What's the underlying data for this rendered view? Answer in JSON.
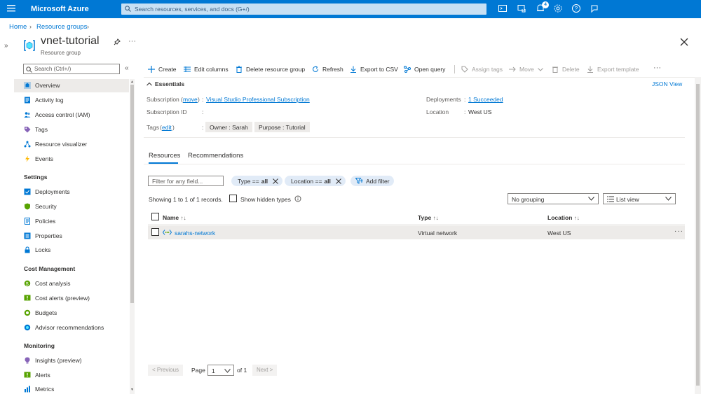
{
  "topbar": {
    "brand": "Microsoft Azure",
    "search_placeholder": "Search resources, services, and docs (G+/)",
    "notification_count": "4"
  },
  "breadcrumb": {
    "home": "Home",
    "resource_groups": "Resource groups"
  },
  "page": {
    "title": "vnet-tutorial",
    "subtitle": "Resource group"
  },
  "nav": {
    "search_placeholder": "Search (Ctrl+/)",
    "items_top": [
      "Overview",
      "Activity log",
      "Access control (IAM)",
      "Tags",
      "Resource visualizer",
      "Events"
    ],
    "settings_header": "Settings",
    "settings_items": [
      "Deployments",
      "Security",
      "Policies",
      "Properties",
      "Locks"
    ],
    "cost_header": "Cost Management",
    "cost_items": [
      "Cost analysis",
      "Cost alerts (preview)",
      "Budgets",
      "Advisor recommendations"
    ],
    "monitoring_header": "Monitoring",
    "monitoring_items": [
      "Insights (preview)",
      "Alerts",
      "Metrics"
    ]
  },
  "commands": {
    "create": "Create",
    "edit_columns": "Edit columns",
    "delete_rg": "Delete resource group",
    "refresh": "Refresh",
    "export_csv": "Export to CSV",
    "open_query": "Open query",
    "assign_tags": "Assign tags",
    "move": "Move",
    "delete": "Delete",
    "export_template": "Export template"
  },
  "essentials": {
    "header": "Essentials",
    "json_view": "JSON View",
    "subscription_label": "Subscription",
    "move_link": "move",
    "subscription_value": "Visual Studio Professional Subscription",
    "subscription_id_label": "Subscription ID",
    "tags_label": "Tags",
    "edit_link": "edit",
    "tags": [
      "Owner : Sarah",
      "Purpose : Tutorial"
    ],
    "deployments_label": "Deployments",
    "deployments_value": "1 Succeeded",
    "location_label": "Location",
    "location_value": "West US",
    "colon": ":"
  },
  "tabs": {
    "resources": "Resources",
    "recommendations": "Recommendations"
  },
  "filters": {
    "placeholder": "Filter for any field...",
    "type_label": "Type ==",
    "type_value": "all",
    "location_label": "Location ==",
    "location_value": "all",
    "add_filter": "Add filter",
    "showing": "Showing 1 to 1 of 1 records.",
    "show_hidden": "Show hidden types",
    "grouping": "No grouping",
    "view": "List view"
  },
  "table": {
    "headers": {
      "name": "Name",
      "type": "Type",
      "location": "Location"
    },
    "rows": [
      {
        "name": "sarahs-network",
        "type": "Virtual network",
        "location": "West US"
      }
    ]
  },
  "pager": {
    "previous": "< Previous",
    "page_label": "Page",
    "page_value": "1",
    "of": "of 1",
    "next": "Next >"
  },
  "colors": {
    "accent": "#0078d4",
    "selected": "#edebe9"
  }
}
